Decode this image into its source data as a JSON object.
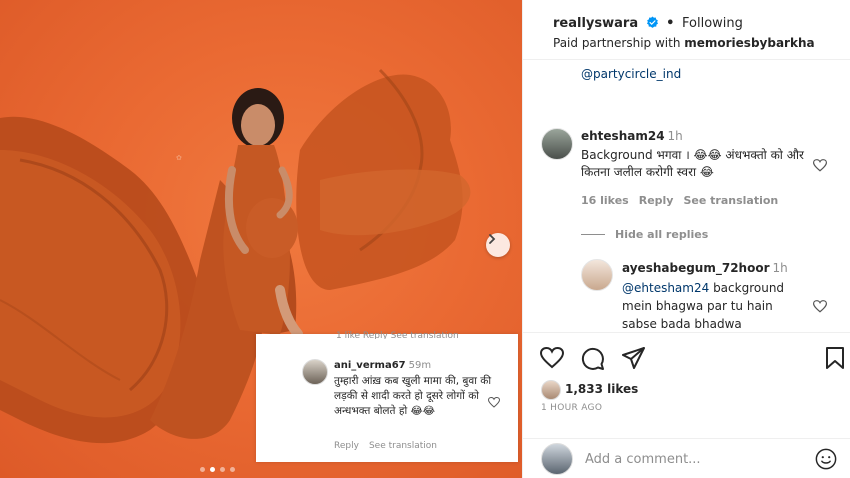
{
  "post": {
    "photo_alt": "",
    "slide_dots": 4,
    "active_slide": 1
  },
  "overlay_comment": {
    "cut_text": "1 like   Reply   See translation",
    "username": "ani_verma67",
    "time": "59m",
    "text": "तुम्हारी आंख़ कब खुली मामा की, बुवा की लड़की से शादी करते हो दूसरे लोगों को अन्धभक्त बोलते हो 😂😂",
    "reply": "Reply",
    "see_translation": "See translation"
  },
  "header": {
    "username": "reallyswara",
    "dot": "•",
    "follow_status": "Following",
    "partnership_prefix": "Paid partnership with ",
    "partner": "memoriesbybarkha"
  },
  "caption_tag": "@partycircle_ind",
  "comments": [
    {
      "username": "ehtesham24",
      "time": "1h",
      "text": "Background भगवा । 😂😂 अंधभक्तो को और कितना जलील करोगी स्वरा 😂",
      "likes": "16 likes",
      "reply": "Reply",
      "see_translation": "See translation"
    }
  ],
  "hide_replies": "Hide all replies",
  "reply": {
    "username": "ayeshabegum_72hoor",
    "time": "1h",
    "mention": "@ehtesham24",
    "text": " background mein bhagwa par tu hain sabse bada bhadwa"
  },
  "actions": {
    "likes": "1,833 likes",
    "posted": "1 HOUR AGO"
  },
  "add_comment": {
    "placeholder": "Add a comment..."
  },
  "colors": {
    "photo_bg": "#ea6a33",
    "dress": "#c1531f",
    "link": "#00376b",
    "muted": "#8e8e8e",
    "verified": "#0095f6"
  },
  "icons": [
    "heart-icon",
    "comment-icon",
    "share-icon",
    "bookmark-icon",
    "emoji-icon",
    "chevron-right-icon",
    "verified-icon"
  ]
}
